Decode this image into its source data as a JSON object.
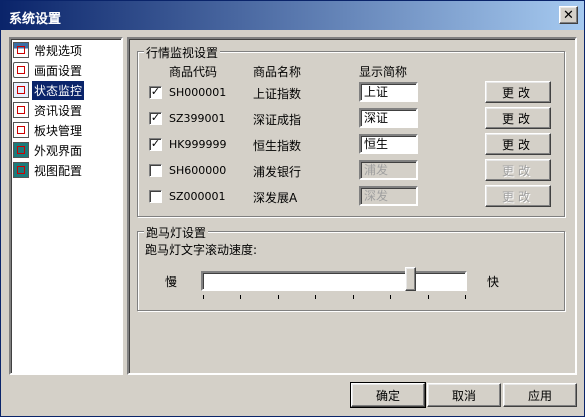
{
  "window": {
    "title": "系统设置",
    "close_glyph": "✕"
  },
  "nav": {
    "items": [
      {
        "label": "常规选项",
        "icon": "general-options-icon",
        "selected": false
      },
      {
        "label": "画面设置",
        "icon": "display-settings-icon",
        "selected": false
      },
      {
        "label": "状态监控",
        "icon": "status-monitor-icon",
        "selected": true
      },
      {
        "label": "资讯设置",
        "icon": "info-settings-icon",
        "selected": false
      },
      {
        "label": "板块管理",
        "icon": "sector-manage-icon",
        "selected": false
      },
      {
        "label": "外观界面",
        "icon": "appearance-icon",
        "selected": false
      },
      {
        "label": "视图配置",
        "icon": "view-config-icon",
        "selected": false
      }
    ]
  },
  "market_group": {
    "title": "行情监视设置",
    "headers": {
      "code": "商品代码",
      "name": "商品名称",
      "short": "显示简称"
    },
    "check_glyph": "✓",
    "rows": [
      {
        "checked": true,
        "code": "SH000001",
        "name": "上证指数",
        "short": "上证",
        "enabled": true,
        "button": "更改"
      },
      {
        "checked": true,
        "code": "SZ399001",
        "name": "深证成指",
        "short": "深证",
        "enabled": true,
        "button": "更改"
      },
      {
        "checked": true,
        "code": "HK999999",
        "name": "恒生指数",
        "short": "恒生",
        "enabled": true,
        "button": "更改"
      },
      {
        "checked": false,
        "code": "SH600000",
        "name": "浦发银行",
        "short": "浦发",
        "enabled": false,
        "button": "更改"
      },
      {
        "checked": false,
        "code": "SZ000001",
        "name": "深发展A",
        "short": "深发",
        "enabled": false,
        "button": "更改"
      }
    ]
  },
  "marquee_group": {
    "title": "跑马灯设置",
    "speed_label": "跑马灯文字滚动速度:",
    "slow_label": "慢",
    "fast_label": "快",
    "speed_fraction": 0.79,
    "tick_count": 8
  },
  "footer": {
    "ok": "确定",
    "cancel": "取消",
    "apply": "应用"
  },
  "colors": {
    "selection": "#0a246a",
    "face": "#d4d0c8"
  }
}
